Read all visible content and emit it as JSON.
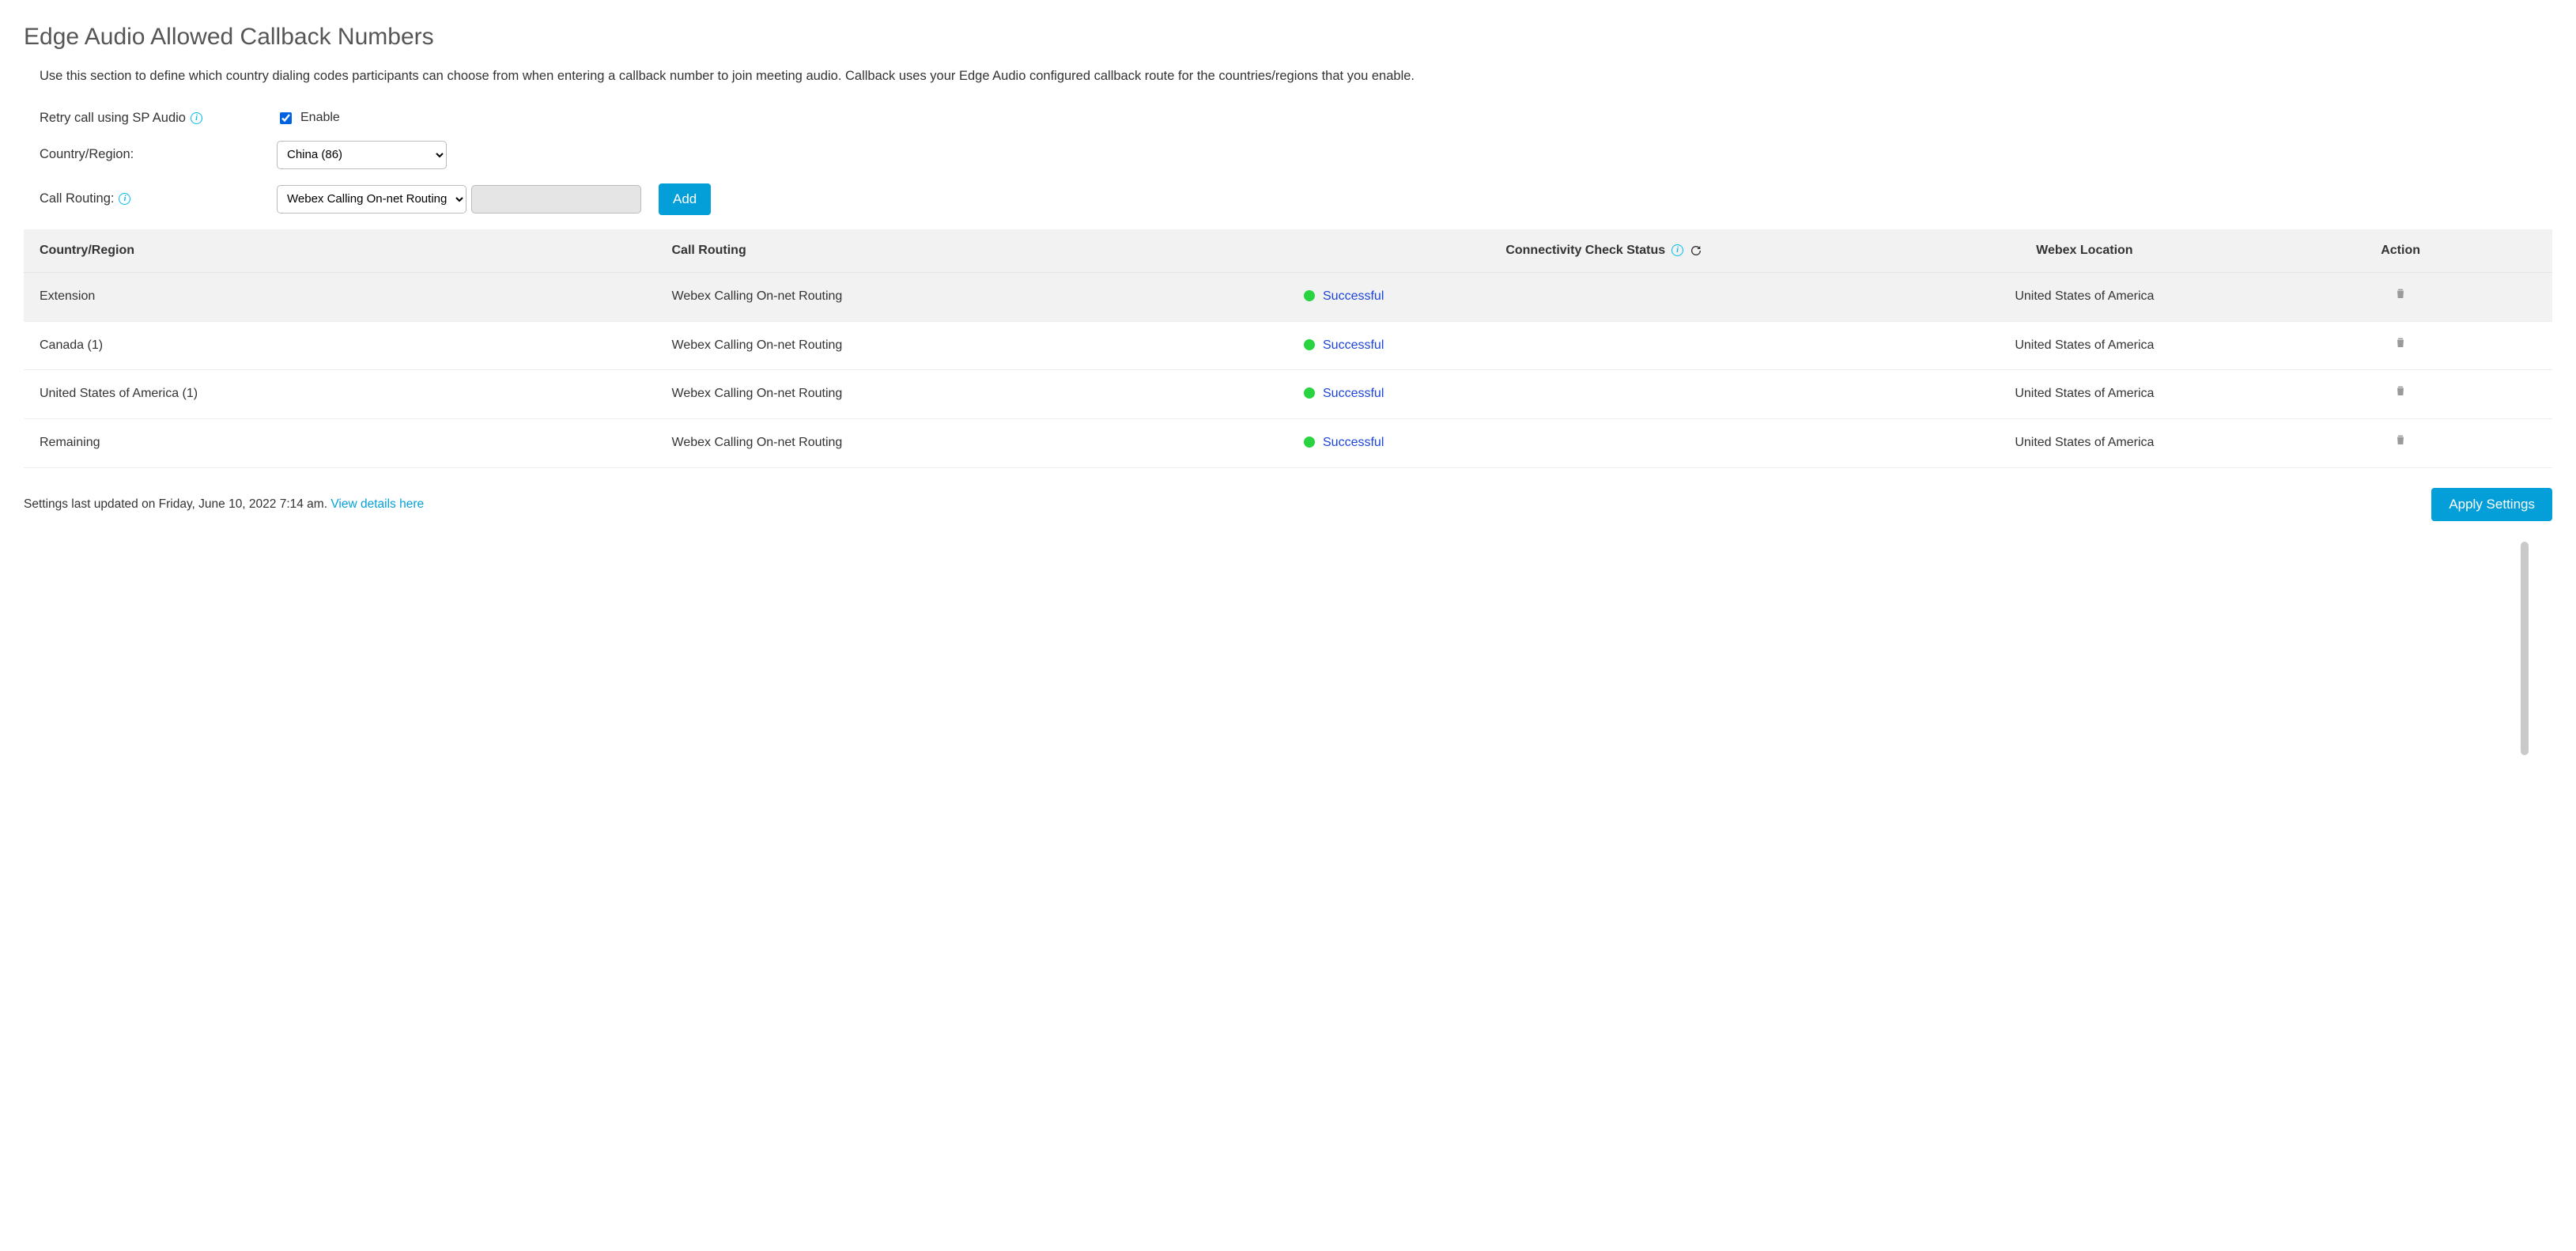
{
  "page": {
    "title": "Edge Audio Allowed Callback Numbers",
    "description": "Use this section to define which country dialing codes participants can choose from when entering a callback number to join meeting audio. Callback uses your Edge Audio configured callback route for the countries/regions that you enable."
  },
  "form": {
    "retry_label": "Retry call using SP Audio",
    "enable_label": "Enable",
    "enable_checked": true,
    "country_label": "Country/Region:",
    "country_value": "China (86)",
    "routing_label": "Call Routing:",
    "routing_value": "Webex Calling On-net Routing",
    "add_button": "Add"
  },
  "table": {
    "headers": {
      "country": "Country/Region",
      "routing": "Call Routing",
      "status": "Connectivity Check Status",
      "location": "Webex Location",
      "action": "Action"
    },
    "rows": [
      {
        "country": "Extension",
        "routing": "Webex Calling On-net Routing",
        "status_text": "Successful",
        "status_color": "#2ad440",
        "location": "United States of America"
      },
      {
        "country": "Canada  (1)",
        "routing": "Webex Calling On-net Routing",
        "status_text": "Successful",
        "status_color": "#2ad440",
        "location": "United States of America"
      },
      {
        "country": "United States of America  (1)",
        "routing": "Webex Calling On-net Routing",
        "status_text": "Successful",
        "status_color": "#2ad440",
        "location": "United States of America"
      },
      {
        "country": "Remaining",
        "routing": "Webex Calling On-net Routing",
        "status_text": "Successful",
        "status_color": "#2ad440",
        "location": "United States of America"
      }
    ]
  },
  "footer": {
    "updated_prefix": "Settings last updated on ",
    "updated_time": " Friday, June 10, 2022 7:14 am. ",
    "details_link": "View details here",
    "apply_button": "Apply Settings"
  }
}
